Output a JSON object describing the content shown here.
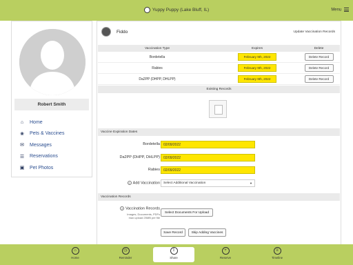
{
  "topbar": {
    "title": "Yuppy Puppy (Lake Bluff, IL)",
    "menu_label": "Menu"
  },
  "sidebar": {
    "user_name": "Robert Smith",
    "items": [
      {
        "label": "Home",
        "icon": "home-icon"
      },
      {
        "label": "Pets & Vaccines",
        "icon": "paw-icon"
      },
      {
        "label": "Messages",
        "icon": "envelope-icon"
      },
      {
        "label": "Reservations",
        "icon": "list-icon"
      },
      {
        "label": "Pet Photos",
        "icon": "photo-icon"
      }
    ]
  },
  "pet": {
    "name": "Fiddo",
    "update_link": "Update Vaccination Records"
  },
  "vaccine_table": {
    "headers": [
      "Vaccination Type",
      "Expires",
      "Delete"
    ],
    "rows": [
      {
        "type": "Bordetella",
        "expires": "February 9th, 2022",
        "delete": "Delete Record"
      },
      {
        "type": "Rabies",
        "expires": "February 9th, 2022",
        "delete": "Delete Record"
      },
      {
        "type": "Da2PP (DHPP, DHLPP)",
        "expires": "February 9th, 2022",
        "delete": "Delete Record"
      }
    ],
    "existing_records_label": "Existing Records"
  },
  "expiration_section": {
    "header": "Vaccine Expiration Dates",
    "fields": [
      {
        "label": "Bordetella",
        "value": "02/09/2022"
      },
      {
        "label": "Da2PP (DHPP, DHLPP)",
        "value": "02/09/2022"
      },
      {
        "label": "Rabies",
        "value": "02/09/2022"
      }
    ],
    "add_vaccination_label": "Add Vaccination",
    "add_vaccination_select": "Select Additional Vaccination"
  },
  "records_section": {
    "header": "Vaccination Records",
    "label": "Vaccination Records",
    "hint_line1": "Images, Documents, PDFs",
    "hint_line2": "max upload 25MB per file",
    "upload_button": "Select Documents For Upload",
    "save_button": "Save Record",
    "skip_button": "Skip Adding Vaccines"
  },
  "bottom_nav": [
    {
      "label": "Home",
      "icon": "home-icon"
    },
    {
      "label": "Reminder",
      "icon": "clock-icon"
    },
    {
      "label": "Share",
      "icon": "share-icon"
    },
    {
      "label": "Reserve",
      "icon": "plus-icon"
    },
    {
      "label": "Timeline",
      "icon": "timeline-icon"
    }
  ],
  "colors": {
    "brand": "#b9cf60",
    "highlight": "#ffe600",
    "nav_text": "#2a4d8f"
  }
}
